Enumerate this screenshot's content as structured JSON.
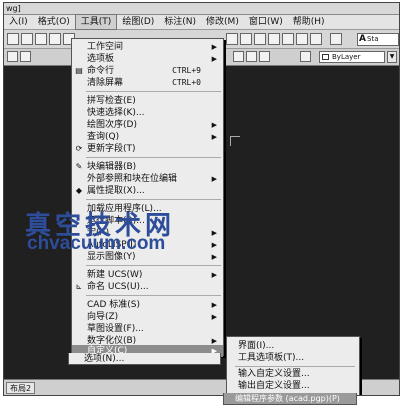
{
  "window": {
    "title": "wg]"
  },
  "menubar": {
    "items": [
      {
        "label": "入(I)"
      },
      {
        "label": "格式(O)"
      },
      {
        "label": "工具(T)"
      },
      {
        "label": "绘图(D)"
      },
      {
        "label": "标注(N)"
      },
      {
        "label": "修改(M)"
      },
      {
        "label": "窗口(W)"
      },
      {
        "label": "帮助(H)"
      }
    ]
  },
  "toolbar": {
    "style_box": "Sta"
  },
  "properties": {
    "layer_value": "ByLayer"
  },
  "tools_menu": {
    "items": [
      {
        "label": "工作空间",
        "shortcut": "",
        "submenu": true
      },
      {
        "label": "选项板",
        "shortcut": "",
        "submenu": true
      },
      {
        "label": "命令行",
        "shortcut": "CTRL+9",
        "submenu": false
      },
      {
        "label": "清除屏幕",
        "shortcut": "CTRL+0",
        "submenu": false
      },
      {
        "label": "拼写检查(E)",
        "shortcut": "",
        "submenu": false
      },
      {
        "label": "快速选择(K)...",
        "shortcut": "",
        "submenu": false
      },
      {
        "label": "绘图次序(D)",
        "shortcut": "",
        "submenu": true
      },
      {
        "label": "查询(Q)",
        "shortcut": "",
        "submenu": true
      },
      {
        "label": "更新字段(T)",
        "shortcut": "",
        "submenu": false
      },
      {
        "label": "块编辑器(B)",
        "shortcut": "",
        "submenu": false
      },
      {
        "label": "外部参照和块在位编辑",
        "shortcut": "",
        "submenu": true
      },
      {
        "label": "属性提取(X)...",
        "shortcut": "",
        "submenu": false
      },
      {
        "label": "加载应用程序(L)...",
        "shortcut": "",
        "submenu": false
      },
      {
        "label": "运行脚本(R)...",
        "shortcut": "",
        "submenu": false
      },
      {
        "label": "宏(A)",
        "shortcut": "",
        "submenu": true
      },
      {
        "label": "AutoLISP(I)",
        "shortcut": "",
        "submenu": true
      },
      {
        "label": "显示图像(Y)",
        "shortcut": "",
        "submenu": true
      },
      {
        "label": "新建 UCS(W)",
        "shortcut": "",
        "submenu": true
      },
      {
        "label": "命名 UCS(U)...",
        "shortcut": "",
        "submenu": false
      },
      {
        "label": "CAD 标准(S)",
        "shortcut": "",
        "submenu": true
      },
      {
        "label": "向导(Z)",
        "shortcut": "",
        "submenu": true
      },
      {
        "label": "草图设置(F)...",
        "shortcut": "",
        "submenu": false
      },
      {
        "label": "数字化仪(B)",
        "shortcut": "",
        "submenu": true
      },
      {
        "label": "自定义(C)",
        "shortcut": "",
        "submenu": true
      },
      {
        "label": "选项(N)...",
        "shortcut": "",
        "submenu": false
      }
    ]
  },
  "custom_submenu": {
    "items": [
      {
        "label": "界面(I)..."
      },
      {
        "label": "工具选项板(T)..."
      },
      {
        "label": "输入自定义设置..."
      },
      {
        "label": "输出自定义设置..."
      },
      {
        "label": "编辑程序参数 (acad.pgp)(P)"
      }
    ]
  },
  "status": {
    "tab_label": "布局2"
  },
  "watermark": {
    "title": "真空技术网",
    "url": "chvacuum.com"
  }
}
